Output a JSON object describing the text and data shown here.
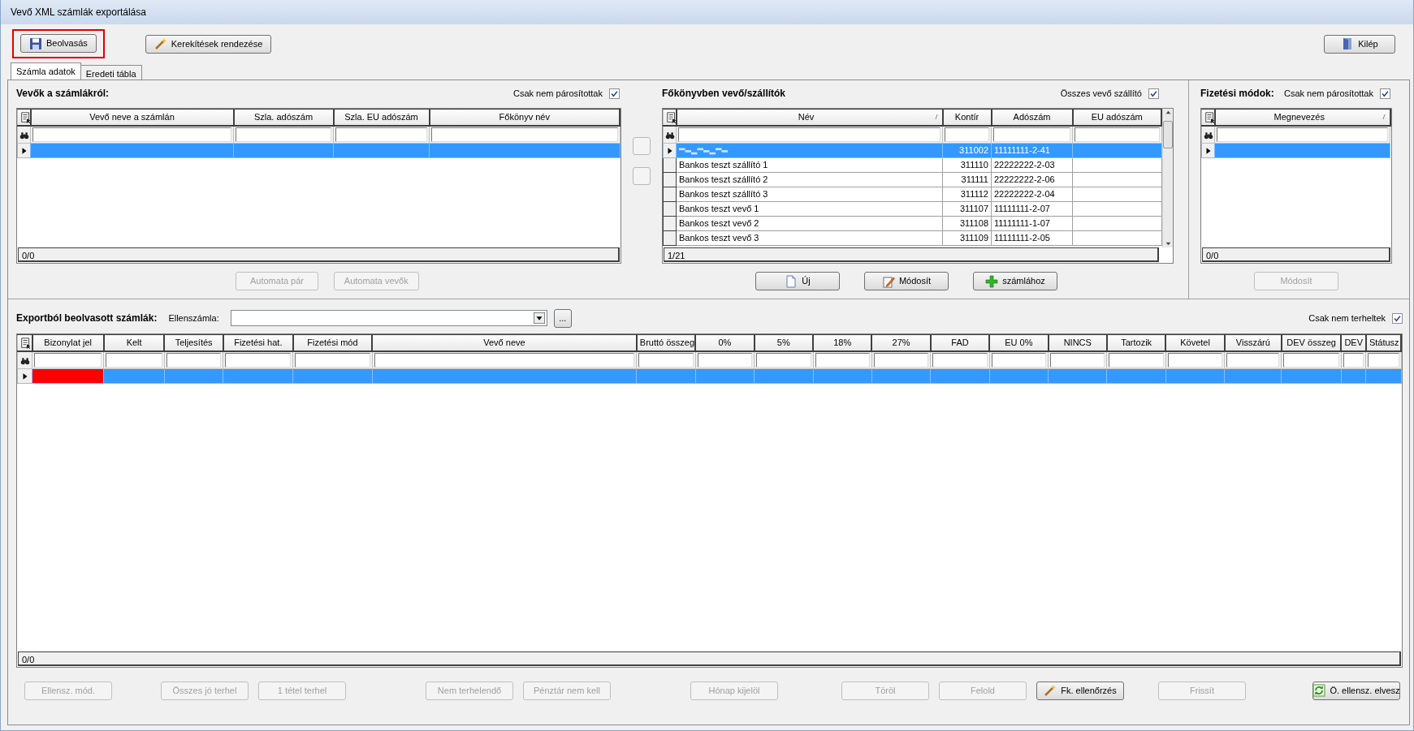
{
  "window": {
    "title": "Vevő XML számlák exportálása"
  },
  "toolbar": {
    "buttons": [
      {
        "label": "Beolvasás",
        "kind": "save",
        "highlighted": true
      },
      {
        "label": "Kerekítések rendezése",
        "kind": "wand",
        "highlighted": false
      }
    ],
    "exit": {
      "label": "Kilép",
      "kind": "exit"
    }
  },
  "tabs": [
    {
      "label": "Számla adatok",
      "selected": true
    },
    {
      "label": "Eredeti tábla",
      "selected": false
    }
  ],
  "customers": {
    "title": "Vevők a számlákról:",
    "filter": {
      "label": "Csak nem párosítottak",
      "checked": true
    },
    "columns": [
      {
        "label": "Vevő neve a számlán"
      },
      {
        "label": "Szla. adószám"
      },
      {
        "label": "Szla. EU adószám"
      },
      {
        "label": "Főkönyv név"
      }
    ],
    "rows": [
      {
        "selected": true
      }
    ],
    "footer": "0/0",
    "buttons": [
      {
        "label": "Automata pár",
        "disabled": true
      },
      {
        "label": "Automata vevők",
        "disabled": true
      }
    ]
  },
  "ledger": {
    "title": "Főkönyvben vevő/szállítók",
    "filter": {
      "label": "Összes vevő szállító",
      "checked": true
    },
    "columns": [
      {
        "label": "Név",
        "sorted": true
      },
      {
        "label": "Kontír",
        "sorted": false
      },
      {
        "label": "Adószám",
        "sorted": false
      },
      {
        "label": "EU adószám",
        "sorted": false
      }
    ],
    "rows": [
      {
        "selected": true,
        "redacted": true,
        "account": "311002",
        "tax_id": "11111111-2-41"
      },
      {
        "selected": false,
        "name": "Bankos teszt szállító 1",
        "account": "311110",
        "tax_id": "22222222-2-03"
      },
      {
        "selected": false,
        "name": "Bankos teszt szállító 2",
        "account": "311111",
        "tax_id": "22222222-2-06"
      },
      {
        "selected": false,
        "name": "Bankos teszt szállító 3",
        "account": "311112",
        "tax_id": "22222222-2-04"
      },
      {
        "selected": false,
        "name": "Bankos teszt vevő 1",
        "account": "311107",
        "tax_id": "11111111-2-07"
      },
      {
        "selected": false,
        "name": "Bankos teszt vevő 2",
        "account": "311108",
        "tax_id": "11111111-1-07"
      },
      {
        "selected": false,
        "name": "Bankos teszt vevő 3",
        "account": "311109",
        "tax_id": "11111111-2-05"
      }
    ],
    "footer": "1/21",
    "buttons": [
      {
        "label": "Új",
        "kind": "new",
        "disabled": false
      },
      {
        "label": "Módosít",
        "kind": "edit",
        "disabled": false
      },
      {
        "label": "számlához",
        "kind": "add",
        "disabled": false
      }
    ]
  },
  "payment": {
    "title": "Fizetési módok:",
    "filter": {
      "label": "Csak nem párosítottak",
      "checked": true
    },
    "columns": [
      {
        "label": "Megnevezés",
        "sorted": true
      }
    ],
    "rows": [
      {
        "selected": true
      }
    ],
    "footer": "0/0",
    "buttons": [
      {
        "label": "Módosít",
        "disabled": true
      }
    ]
  },
  "invoices": {
    "title": "Exportból beolvasott számlák:",
    "counter_account": {
      "label": "Ellenszámla:"
    },
    "browse_button": "...",
    "filter": {
      "label": "Csak nem terheltek",
      "checked": true
    },
    "columns": [
      {
        "label": "Bizonylat jel"
      },
      {
        "label": "Kelt"
      },
      {
        "label": "Teljesítés"
      },
      {
        "label": "Fizetési hat."
      },
      {
        "label": "Fizetési mód"
      },
      {
        "label": "Vevő neve"
      },
      {
        "label": "Bruttó összeg"
      },
      {
        "label": "0%"
      },
      {
        "label": "5%"
      },
      {
        "label": "18%"
      },
      {
        "label": "27%"
      },
      {
        "label": "FAD"
      },
      {
        "label": "EU 0%"
      },
      {
        "label": "NINCS"
      },
      {
        "label": "Tartozik"
      },
      {
        "label": "Követel"
      },
      {
        "label": "Visszárú"
      },
      {
        "label": "DEV összeg"
      },
      {
        "label": "DEV"
      },
      {
        "label": "Státusz"
      }
    ],
    "rows": [
      {
        "selected": true,
        "flagged": true
      }
    ],
    "footer": "0/0",
    "buttons": [
      {
        "label": "Ellensz. mód.",
        "disabled": true
      },
      {
        "label": "Összes jó terhel",
        "disabled": true
      },
      {
        "label": "1 tétel terhel",
        "disabled": true
      },
      {
        "label": "Nem terhelendő",
        "disabled": true
      },
      {
        "label": "Pénztár nem kell",
        "disabled": true
      },
      {
        "label": "Hónap kijelöl",
        "disabled": true
      },
      {
        "label": "Töröl",
        "disabled": true
      },
      {
        "label": "Felold",
        "disabled": true
      },
      {
        "label": "Fk. ellenőrzés",
        "kind": "wand",
        "disabled": false
      },
      {
        "label": "Frissít",
        "disabled": true
      },
      {
        "label": "Ö. ellensz. elvesz",
        "kind": "refresh",
        "disabled": false
      }
    ]
  }
}
